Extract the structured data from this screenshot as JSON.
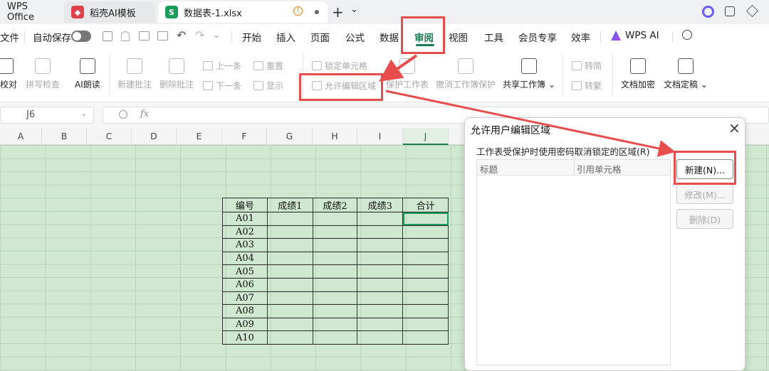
{
  "tabs": {
    "wps_label": "WPS Office",
    "doc1_label": "稻壳AI模板",
    "doc2_label": "数据表-1.xlsx",
    "new_tab_symbol": "+",
    "menu_symbol": "⌄"
  },
  "menu": {
    "file": "文件",
    "autosave": "自动保存",
    "items": [
      "开始",
      "插入",
      "页面",
      "公式",
      "数据",
      "审阅",
      "视图",
      "工具",
      "会员专享",
      "效率"
    ],
    "wps_ai": "WPS AI"
  },
  "ribbon": {
    "proof": "校对",
    "spell_check": "拼写检查",
    "ai_read": "AI朗读",
    "new_comment": "新建批注",
    "delete_comment": "删除批注",
    "prev": "上一条",
    "next": "下一条",
    "reset": "重置",
    "show": "显示",
    "lock_cell": "锁定单元格",
    "allow_edit_area": "允许编辑区域",
    "protect_sheet": "保护工作表",
    "unprotect_workbook": "撤消工作簿保护",
    "share_workbook": "共享工作簿",
    "to_simplified": "转简",
    "to_traditional": "转繁",
    "doc_encrypt": "文档加密",
    "doc_finalize": "文档定稿"
  },
  "formula_bar": {
    "name_box": "J6",
    "fx": "fx"
  },
  "columns": [
    "A",
    "B",
    "C",
    "D",
    "E",
    "F",
    "G",
    "H",
    "I",
    "J"
  ],
  "table": {
    "headers": [
      "编号",
      "成绩1",
      "成绩2",
      "成绩3",
      "合计"
    ],
    "ids": [
      "A01",
      "A02",
      "A03",
      "A04",
      "A05",
      "A06",
      "A07",
      "A08",
      "A09",
      "A10"
    ]
  },
  "dialog": {
    "title": "允许用户编辑区域",
    "close": "×",
    "description": "工作表受保护时使用密码取消锁定的区域(R)",
    "col_title": "标题",
    "col_ref": "引用单元格",
    "btn_new": "新建(N)...",
    "btn_modify": "修改(M)...",
    "btn_delete": "删除(D)"
  },
  "colors": {
    "accent": "#1a7d4f",
    "annotation": "#e84d4d",
    "grid_fill": "#cfe8cf"
  }
}
